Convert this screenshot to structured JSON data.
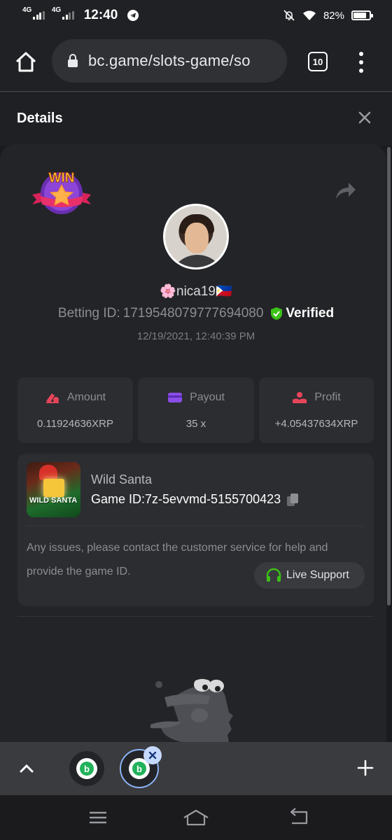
{
  "status_bar": {
    "signal1_label": "4G",
    "signal2_label": "4G",
    "time": "12:40",
    "battery": "82%",
    "battery_level": 0.82
  },
  "browser": {
    "url": "bc.game/slots-game/so",
    "tab_count": "10"
  },
  "details": {
    "title": "Details"
  },
  "profile": {
    "username": "🌸nica19🇵🇭",
    "betting_label": "Betting ID:",
    "betting_id": "1719548079777694080",
    "verified": "Verified",
    "datetime": "12/19/2021, 12:40:39 PM"
  },
  "stats": [
    {
      "label": "Amount",
      "value": "0.11924636XRP",
      "icon": "amount-icon",
      "color": "#e8455a"
    },
    {
      "label": "Payout",
      "value": "35 x",
      "icon": "card-icon",
      "color": "#8a4de8"
    },
    {
      "label": "Profit",
      "value": "+4.05437634XRP",
      "icon": "profit-icon",
      "color": "#e8455a"
    }
  ],
  "game": {
    "name": "Wild Santa",
    "id_label": "Game ID:",
    "id": "7z-5evvmd-5155700423",
    "thumb_text": "WILD SANTA"
  },
  "support": {
    "help_line1": "Any issues, please contact the customer service for help and",
    "help_line2": "provide the game ID.",
    "button": "Live Support",
    "accent": "#3bc117"
  },
  "badge": {
    "text": "WIN"
  },
  "colors": {
    "verified": "#3bc117",
    "tab_active_ring": "#8ab4f8"
  }
}
